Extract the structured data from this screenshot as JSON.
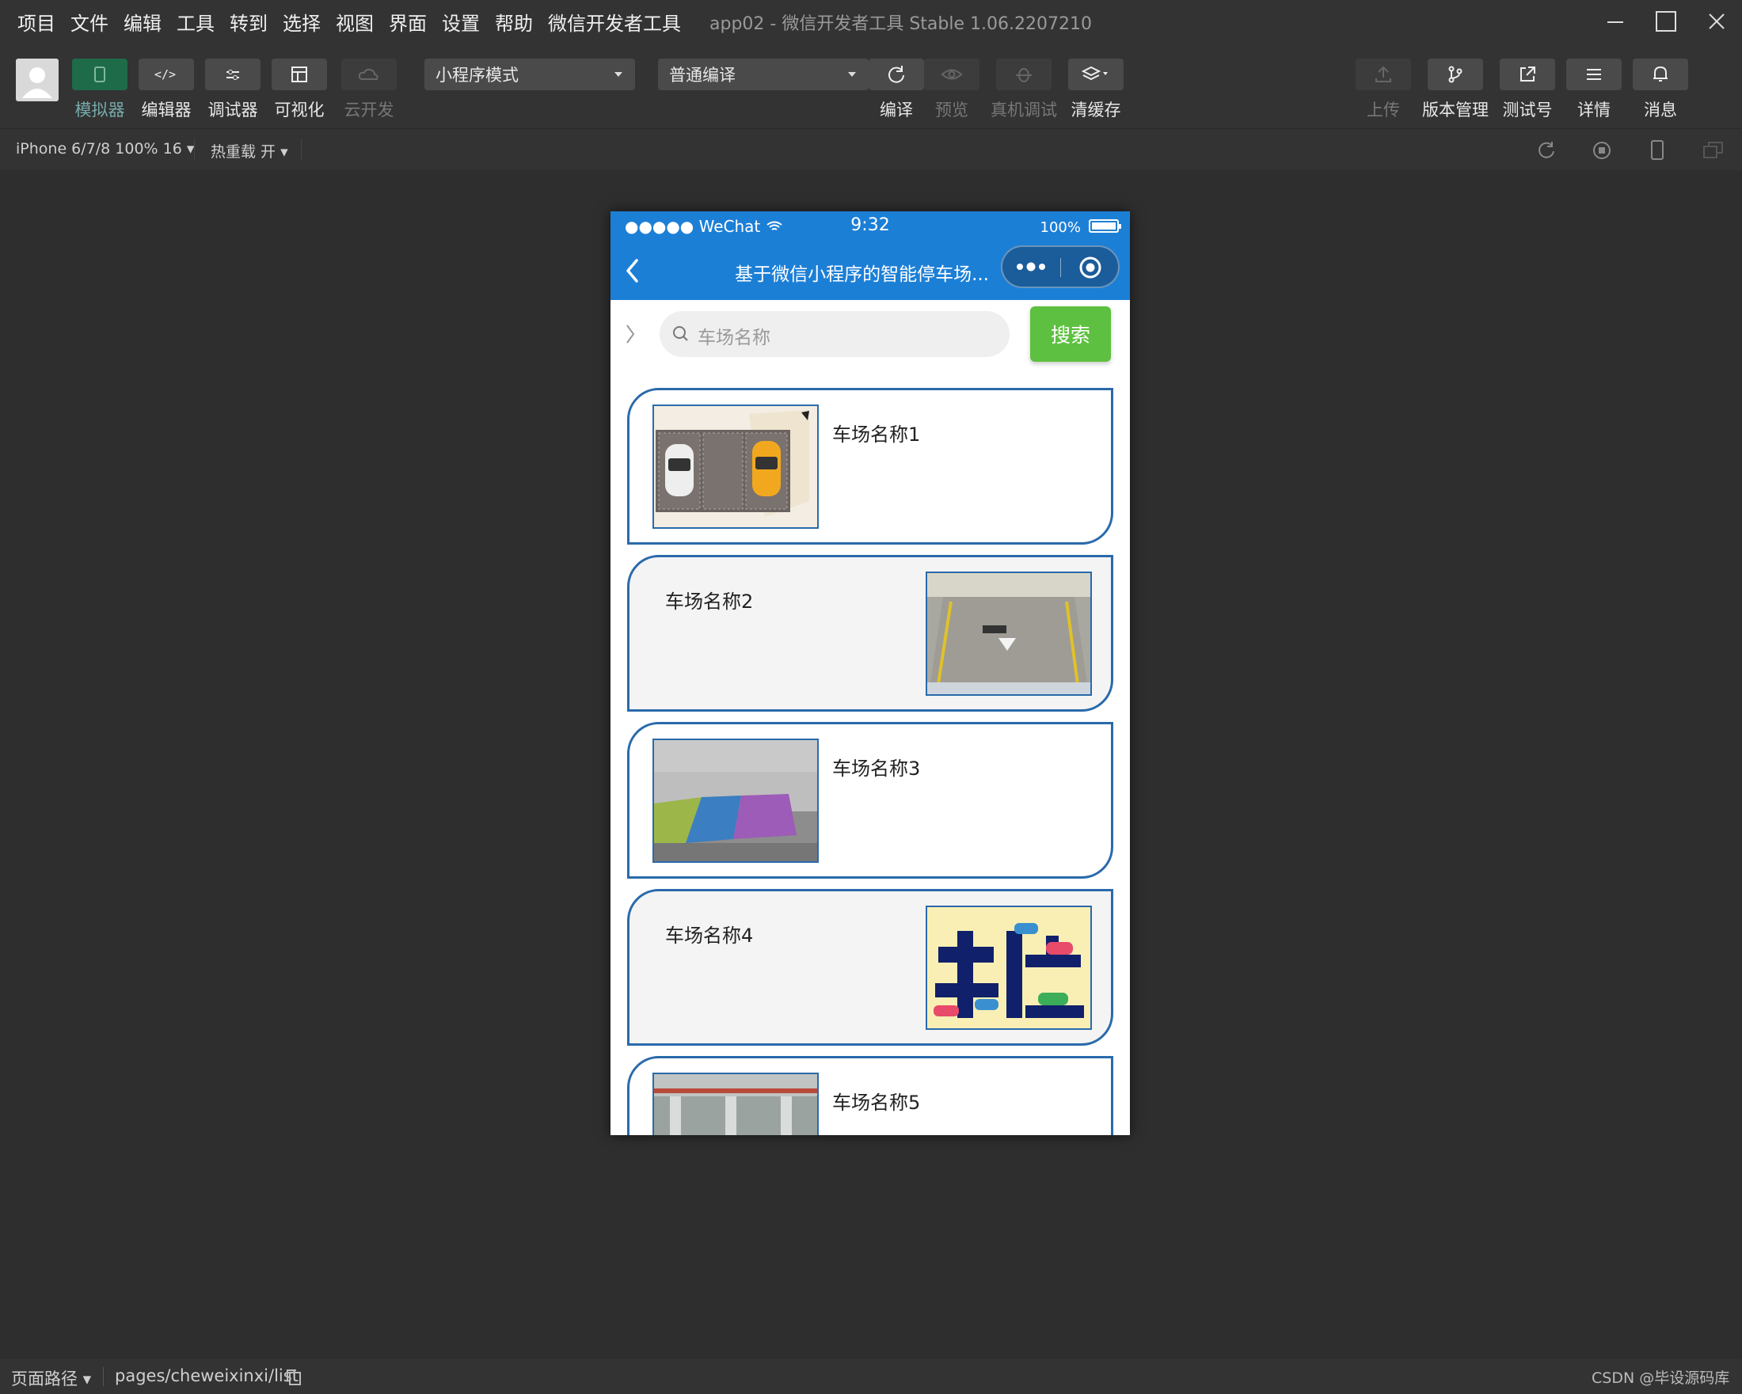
{
  "menubar": {
    "items": [
      "项目",
      "文件",
      "编辑",
      "工具",
      "转到",
      "选择",
      "视图",
      "界面",
      "设置",
      "帮助",
      "微信开发者工具"
    ],
    "window_title": "app02 - 微信开发者工具 Stable 1.06.2207210"
  },
  "toolbar": {
    "simulator": "模拟器",
    "editor": "编辑器",
    "debugger": "调试器",
    "visual": "可视化",
    "cloud": "云开发",
    "mode_select": "小程序模式",
    "compile_select": "普通编译",
    "compile": "编译",
    "preview": "预览",
    "real_debug": "真机调试",
    "clear_cache": "清缓存",
    "upload": "上传",
    "version": "版本管理",
    "test_account": "测试号",
    "details": "详情",
    "messages": "消息"
  },
  "subbar": {
    "device": "iPhone 6/7/8 100% 16 ▾",
    "hot_reload": "热重载 开 ▾"
  },
  "phone": {
    "carrier": "●●●●● WeChat",
    "time": "9:32",
    "battery": "100%",
    "nav_title": "基于微信小程序的智能停车场...",
    "search_placeholder": "车场名称",
    "search_button": "搜索",
    "lots": [
      {
        "name": "车场名称1"
      },
      {
        "name": "车场名称2"
      },
      {
        "name": "车场名称3"
      },
      {
        "name": "车场名称4"
      },
      {
        "name": "车场名称5"
      }
    ]
  },
  "statusbar": {
    "path_label": "页面路径 ▾",
    "path": "pages/cheweixinxi/list",
    "watermark": "CSDN @毕设源码库"
  },
  "colors": {
    "nav_blue": "#1c7fd6",
    "search_green": "#5ec040",
    "card_border": "#2a6aab"
  }
}
